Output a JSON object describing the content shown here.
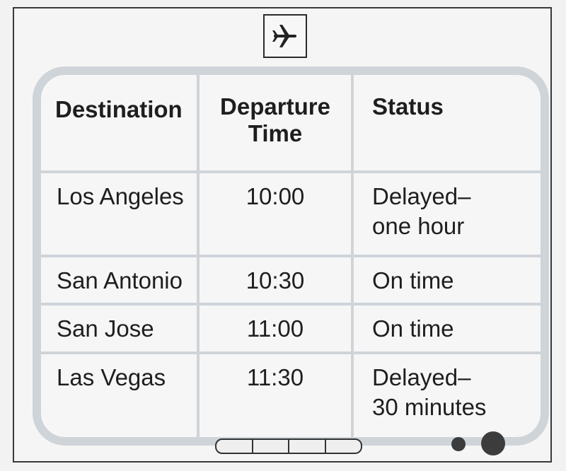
{
  "board": {
    "icon": "airplane-icon",
    "headers": {
      "destination_label": "Destination",
      "departure_label_line1": "Departure",
      "departure_label_line2": "Time",
      "status_label": "Status"
    },
    "rows": [
      {
        "destination": "Los Angeles",
        "time": "10:00",
        "status_line1": "Delayed–",
        "status_line2": "one hour"
      },
      {
        "destination": "San Antonio",
        "time": "10:30",
        "status_line1": "On time",
        "status_line2": ""
      },
      {
        "destination": "San Jose",
        "time": "11:00",
        "status_line1": "On time",
        "status_line2": ""
      },
      {
        "destination": "Las Vegas",
        "time": "11:30",
        "status_line1": "Delayed–",
        "status_line2": "30 minutes"
      }
    ]
  },
  "colors": {
    "frame": "#3a3a3a",
    "screen_border": "#cfd4d9",
    "text": "#1e1e1e"
  }
}
